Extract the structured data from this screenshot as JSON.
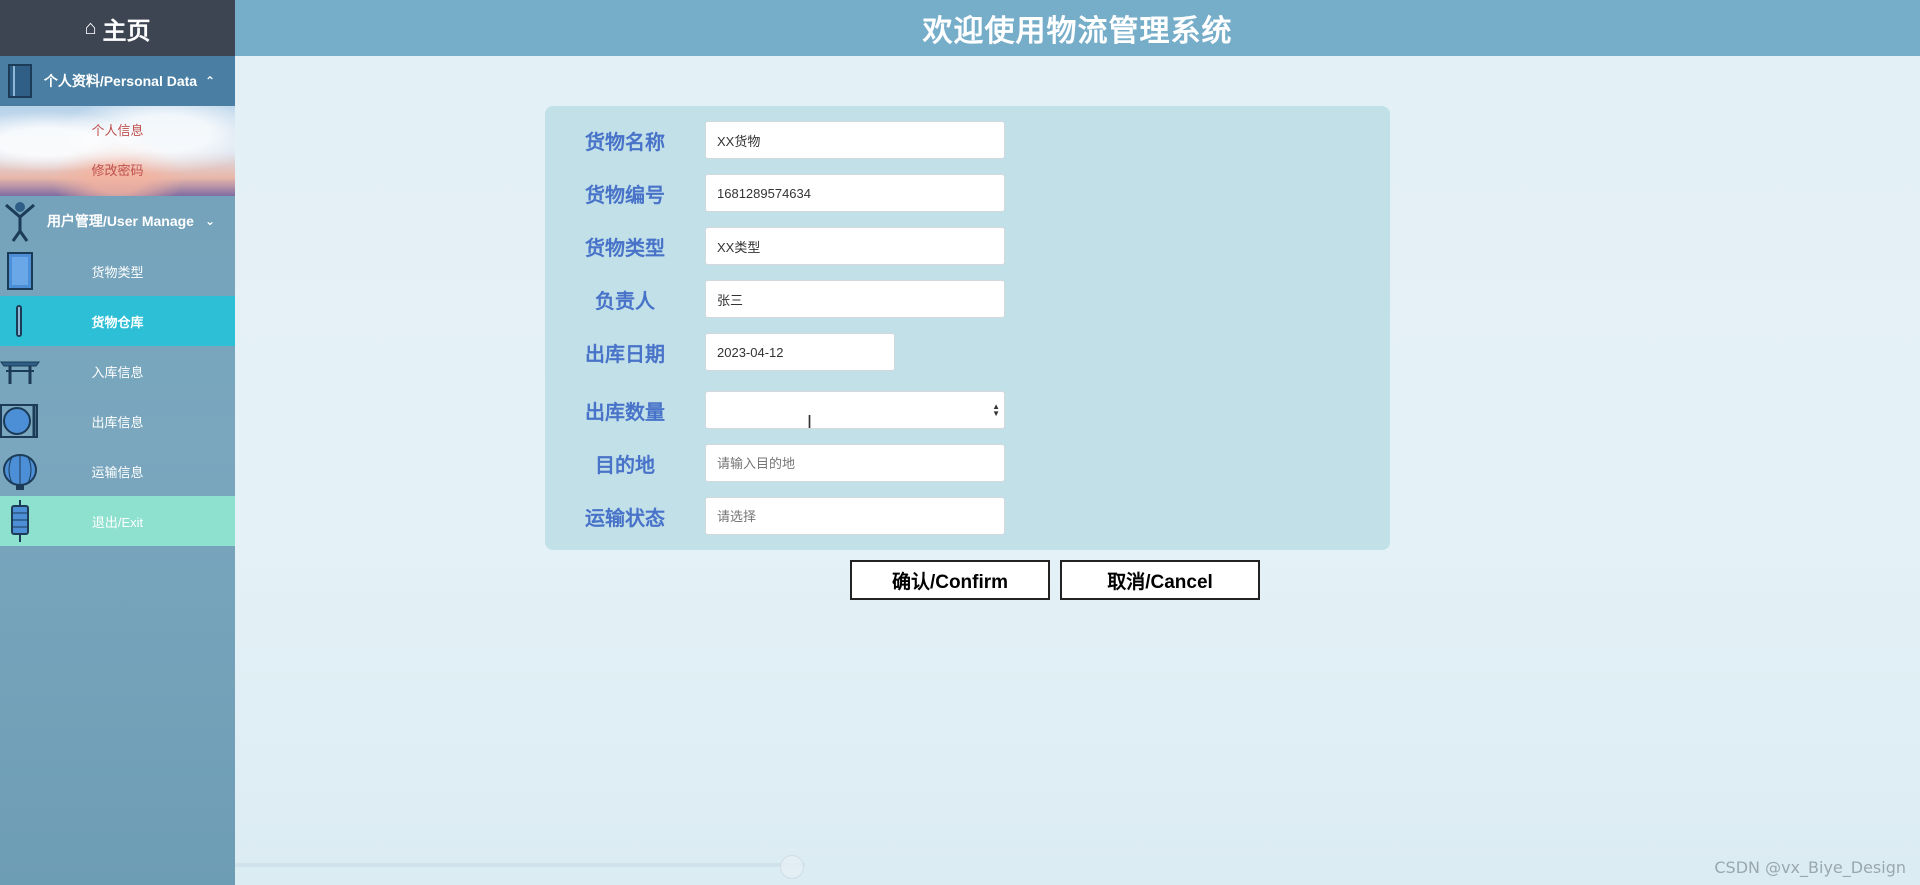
{
  "header": {
    "title": "欢迎使用物流管理系统"
  },
  "sidebar": {
    "home_label": "主页",
    "group_personal": {
      "label": "个人资料/Personal Data",
      "chevron": "⌃"
    },
    "personal_items": [
      "个人信息",
      "修改密码"
    ],
    "group_user": {
      "label": "用户管理/User Manage",
      "chevron": "⌄"
    },
    "items": [
      {
        "label": "货物类型",
        "icon": "book-icon"
      },
      {
        "label": "货物仓库",
        "icon": "scroll-icon",
        "active": true
      },
      {
        "label": "入库信息",
        "icon": "gate-icon"
      },
      {
        "label": "出库信息",
        "icon": "mirror-icon"
      },
      {
        "label": "运输信息",
        "icon": "lantern-icon"
      },
      {
        "label": "退出/Exit",
        "icon": "pagoda-icon"
      }
    ]
  },
  "form": {
    "fields": [
      {
        "label": "货物名称",
        "value": "XX货物"
      },
      {
        "label": "货物编号",
        "value": "1681289574634"
      },
      {
        "label": "货物类型",
        "value": "XX类型"
      },
      {
        "label": "负责人",
        "value": "张三"
      },
      {
        "label": "出库日期",
        "value": "2023-04-12"
      },
      {
        "label": "出库数量",
        "value": ""
      },
      {
        "label": "目的地",
        "placeholder": "请输入目的地"
      },
      {
        "label": "运输状态",
        "placeholder": "请选择"
      }
    ]
  },
  "buttons": {
    "confirm": "确认/Confirm",
    "cancel": "取消/Cancel"
  },
  "watermark": "CSDN @vx_Biye_Design",
  "colors": {
    "header_bg": "#76adc9",
    "sidebar_dark": "#3d4552",
    "active_item": "#2cbfd6",
    "exit_item": "#8ee0cf",
    "label_blue": "#4873c9",
    "panel_bg": "#c2e0e8"
  }
}
